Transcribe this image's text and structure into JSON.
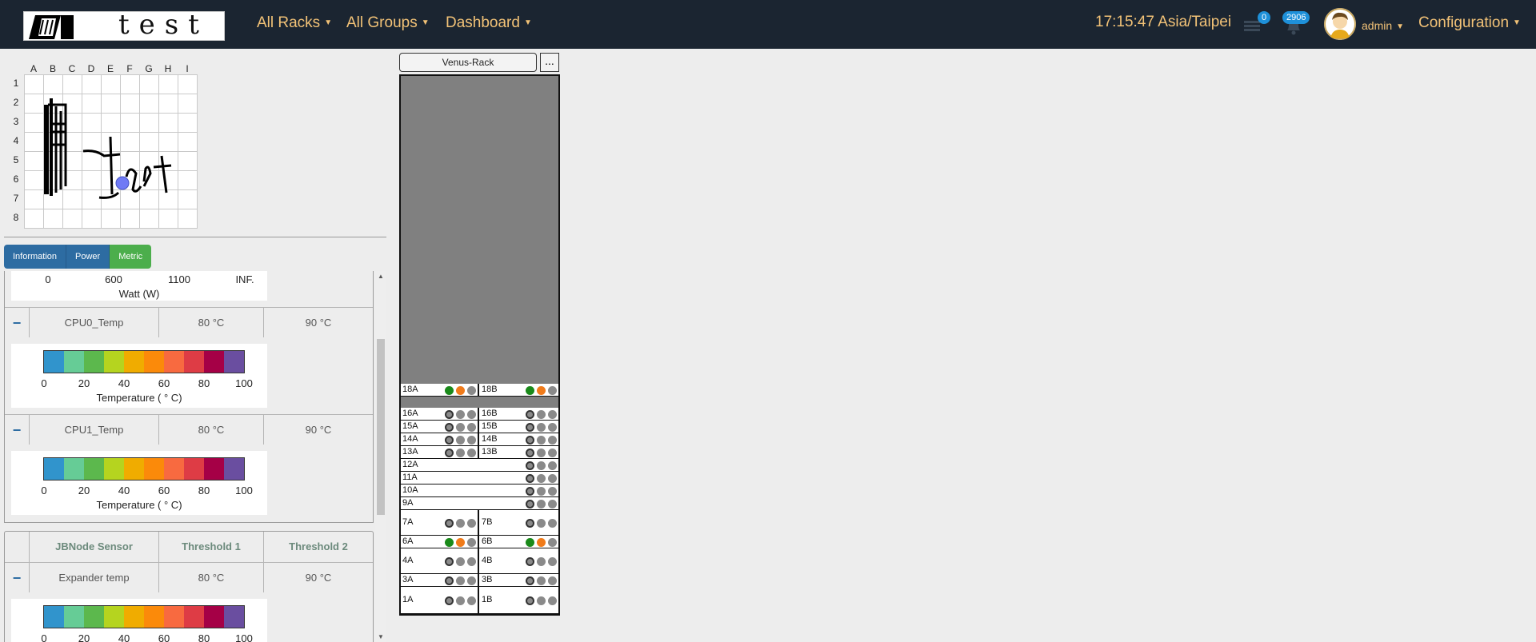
{
  "nav": {
    "menus": [
      "All Racks",
      "All Groups",
      "Dashboard"
    ],
    "clock": "17:15:47 Asia/Taipei",
    "tasks_badge": "0",
    "alerts_badge": "2906",
    "user": "admin",
    "config": "Configuration",
    "logo_text": "test"
  },
  "grid": {
    "cols": [
      "A",
      "B",
      "C",
      "D",
      "E",
      "F",
      "G",
      "H",
      "I"
    ],
    "rows": [
      "1",
      "2",
      "3",
      "4",
      "5",
      "6",
      "7",
      "8"
    ]
  },
  "tabs": [
    "Information",
    "Power",
    "Metric"
  ],
  "power_scale": {
    "ticks": [
      "0",
      "600",
      "1100",
      "INF."
    ],
    "unit": "Watt (W)"
  },
  "sensor_table_1": [
    {
      "toggle": "−",
      "name": "CPU0_Temp",
      "t1": "80 °C",
      "t2": "90 °C"
    },
    {
      "toggle": "−",
      "name": "CPU1_Temp",
      "t1": "80 °C",
      "t2": "90 °C"
    }
  ],
  "temp_scale": {
    "ticks": [
      "0",
      "20",
      "40",
      "60",
      "80",
      "100"
    ],
    "unit": "Temperature ( ° C)"
  },
  "scale_colors": [
    "#3194cc",
    "#66cc96",
    "#5cb84d",
    "#b5d41f",
    "#f0ac00",
    "#fb8a0a",
    "#f86a40",
    "#de3c45",
    "#a50046",
    "#6a4ea0"
  ],
  "sensor_table_2": {
    "headers": [
      "JBNode Sensor",
      "Threshold 1",
      "Threshold 2"
    ],
    "rows": [
      {
        "toggle": "−",
        "name": "Expander temp",
        "t1": "80 °C",
        "t2": "90 °C"
      }
    ]
  },
  "rack": {
    "name": "Venus-Rack",
    "more": "...",
    "units": [
      {
        "a": "18A",
        "b": "18B",
        "ledsA": [
          "green",
          "orange",
          "gray"
        ],
        "ledsB": [
          "green",
          "orange",
          "gray"
        ]
      },
      {
        "a": "16A",
        "b": "16B",
        "ledsA": [
          "ring",
          "gray",
          "gray"
        ],
        "ledsB": [
          "ring",
          "gray",
          "gray"
        ]
      },
      {
        "a": "15A",
        "b": "15B",
        "ledsA": [
          "ring",
          "gray",
          "gray"
        ],
        "ledsB": [
          "ring",
          "gray",
          "gray"
        ]
      },
      {
        "a": "14A",
        "b": "14B",
        "ledsA": [
          "ring",
          "gray",
          "gray"
        ],
        "ledsB": [
          "ring",
          "gray",
          "gray"
        ]
      },
      {
        "a": "13A",
        "b": "13B",
        "ledsA": [
          "ring",
          "gray",
          "gray"
        ],
        "ledsB": [
          "ring",
          "gray",
          "gray"
        ]
      },
      {
        "a": "12A",
        "ledsA": [
          "ring",
          "gray",
          "gray"
        ]
      },
      {
        "a": "11A",
        "ledsA": [
          "ring",
          "gray",
          "gray"
        ]
      },
      {
        "a": "10A",
        "ledsA": [
          "ring",
          "gray",
          "gray"
        ]
      },
      {
        "a": "9A",
        "ledsA": [
          "ring",
          "gray",
          "gray"
        ]
      },
      {
        "a": "7A",
        "b": "7B",
        "ledsA": [
          "ring",
          "gray",
          "gray"
        ],
        "ledsB": [
          "ring",
          "gray",
          "gray"
        ]
      },
      {
        "a": "6A",
        "b": "6B",
        "ledsA": [
          "green",
          "orange",
          "gray"
        ],
        "ledsB": [
          "green",
          "orange",
          "gray"
        ]
      },
      {
        "a": "4A",
        "b": "4B",
        "ledsA": [
          "ring",
          "gray",
          "gray"
        ],
        "ledsB": [
          "ring",
          "gray",
          "gray"
        ]
      },
      {
        "a": "3A",
        "b": "3B",
        "ledsA": [
          "ring",
          "gray",
          "gray"
        ],
        "ledsB": [
          "ring",
          "gray",
          "gray"
        ]
      },
      {
        "a": "1A",
        "b": "1B",
        "ledsA": [
          "ring",
          "gray",
          "gray"
        ],
        "ledsB": [
          "ring",
          "gray",
          "gray"
        ]
      }
    ]
  },
  "colors": {
    "navbar": "#1b2531",
    "nav_text": "#f2c277",
    "tab": "#2d6ca2",
    "tab_active": "#4cae4c",
    "led_green": "#1a8a1a",
    "led_orange": "#f07b1a",
    "led_gray": "#8a8a8a"
  }
}
